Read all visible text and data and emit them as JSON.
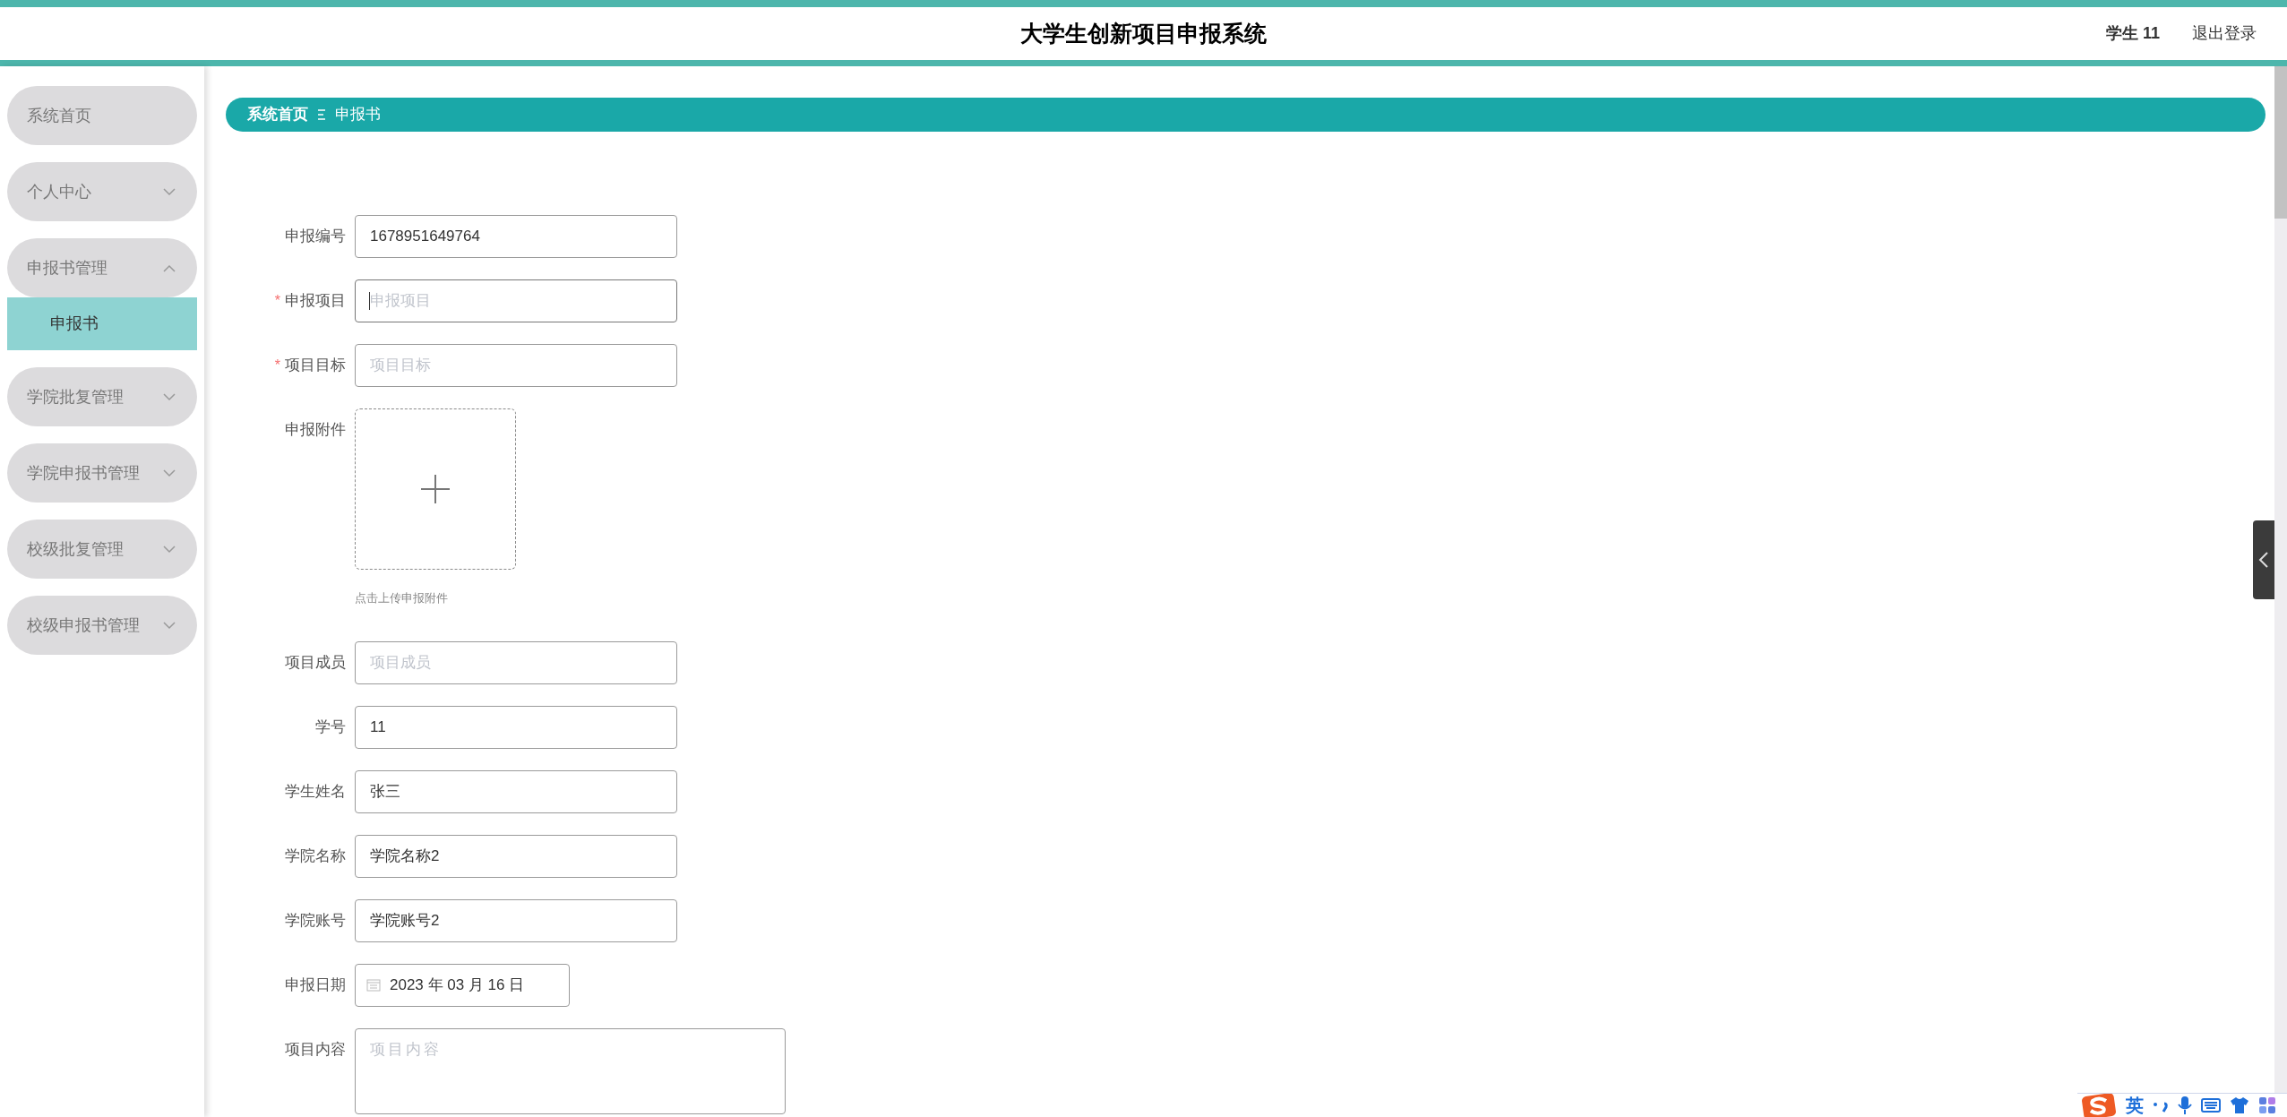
{
  "header": {
    "title": "大学生创新项目申报系统",
    "user": "学生 11",
    "logout": "退出登录"
  },
  "sidebar": {
    "items": [
      {
        "label": "系统首页",
        "kind": "link"
      },
      {
        "label": "个人中心",
        "kind": "menu",
        "expanded": false
      },
      {
        "label": "申报书管理",
        "kind": "menu",
        "expanded": true,
        "children": [
          {
            "label": "申报书",
            "selected": true
          }
        ]
      },
      {
        "label": "学院批复管理",
        "kind": "menu",
        "expanded": false
      },
      {
        "label": "学院申报书管理",
        "kind": "menu",
        "expanded": false
      },
      {
        "label": "校级批复管理",
        "kind": "menu",
        "expanded": false
      },
      {
        "label": "校级申报书管理",
        "kind": "menu",
        "expanded": false
      }
    ]
  },
  "breadcrumb": [
    "系统首页",
    "申报书"
  ],
  "form": {
    "fields": [
      {
        "label": "申报编号",
        "kind": "text",
        "value": "1678951649764"
      },
      {
        "label": "申报项目",
        "kind": "text",
        "required_mark": "*",
        "placeholder": "申报项目",
        "focused": true
      },
      {
        "label": "项目目标",
        "kind": "text",
        "required_mark": "*",
        "placeholder": "项目目标"
      },
      {
        "label": "申报附件",
        "kind": "upload",
        "hint": "点击上传申报附件"
      },
      {
        "label": "项目成员",
        "kind": "text",
        "placeholder": "项目成员"
      },
      {
        "label": "学号",
        "kind": "text",
        "value": "11"
      },
      {
        "label": "学生姓名",
        "kind": "text",
        "value": "张三"
      },
      {
        "label": "学院名称",
        "kind": "text",
        "value": "学院名称2"
      },
      {
        "label": "学院账号",
        "kind": "text",
        "value": "学院账号2"
      },
      {
        "label": "申报日期",
        "kind": "date",
        "value": "2023 年 03 月 16 日"
      },
      {
        "label": "项目内容",
        "kind": "textarea",
        "placeholder": "项目内容"
      }
    ]
  },
  "ime_toolbar": {
    "mode": "英"
  }
}
